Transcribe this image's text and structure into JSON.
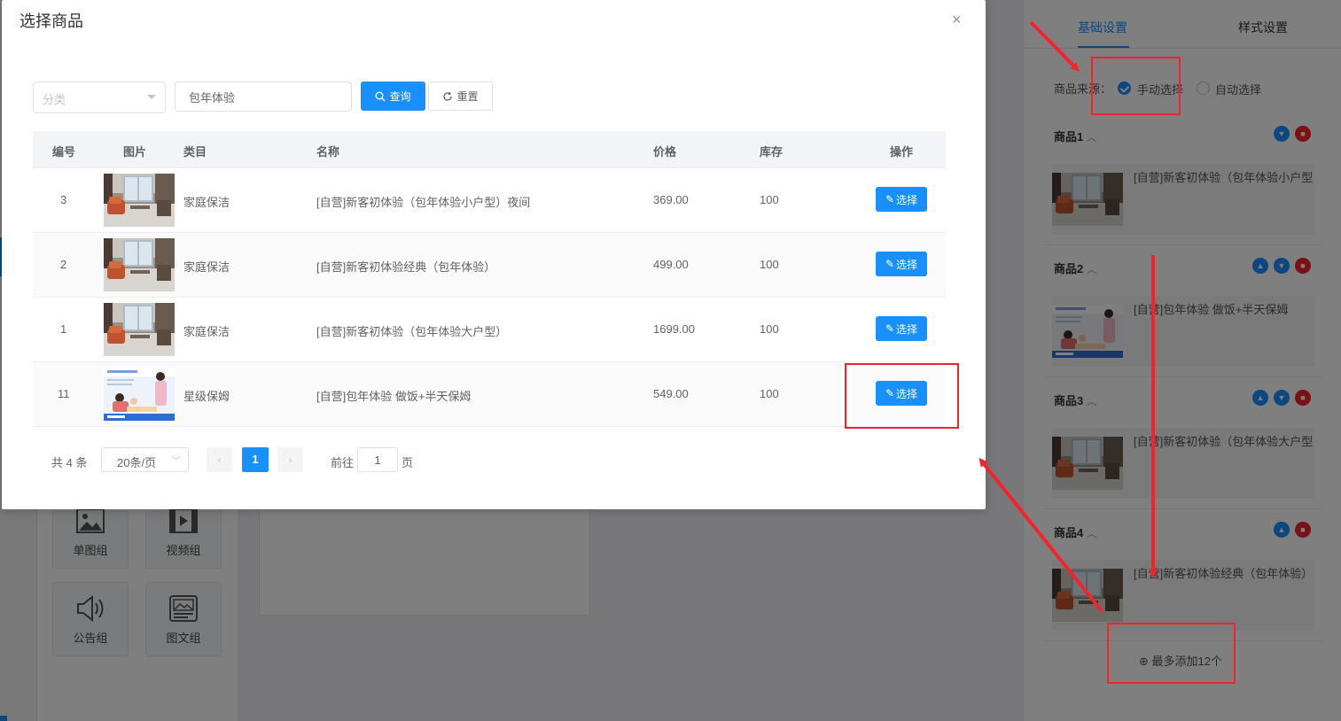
{
  "dialog": {
    "title": "选择商品",
    "close_icon": "×",
    "filter": {
      "category_placeholder": "分类",
      "keyword_value": "包年体验",
      "search_label": "查询",
      "reset_label": "重置"
    },
    "table": {
      "columns": [
        "编号",
        "图片",
        "类目",
        "名称",
        "价格",
        "库存",
        "操作"
      ],
      "rows": [
        {
          "id": "3",
          "category": "家庭保洁",
          "name": "[自营]新客初体验（包年体验小户型）夜间",
          "price": "369.00",
          "stock": "100",
          "action": "选择",
          "image": "living-room-photo"
        },
        {
          "id": "2",
          "category": "家庭保洁",
          "name": "[自营]新客初体验经典（包年体验）",
          "price": "499.00",
          "stock": "100",
          "action": "选择",
          "image": "living-room-photo"
        },
        {
          "id": "1",
          "category": "家庭保洁",
          "name": "[自营]新客初体验（包年体验大户型）",
          "price": "1699.00",
          "stock": "100",
          "action": "选择",
          "image": "living-room-photo"
        },
        {
          "id": "11",
          "category": "星级保姆",
          "name": "[自营]包年体验 做饭+半天保姆",
          "price": "549.00",
          "stock": "100",
          "action": "选择",
          "image": "nanny-photo"
        }
      ]
    },
    "pagination": {
      "total": "共 4 条",
      "page_size": "20条/页",
      "current_page": "1",
      "goto_label": "前往",
      "goto_value": "1",
      "page_suffix": "页"
    }
  },
  "right_panel": {
    "tabs": [
      "基础设置",
      "样式设置"
    ],
    "active_tab": "基础设置",
    "source_label": "商品来源：",
    "source_options": [
      "手动选择",
      "自动选择"
    ],
    "source_selected": "手动选择",
    "products": [
      {
        "label": "商品1",
        "title": "[自营]新客初体验（包年体验小户型",
        "image": "living-room-photo"
      },
      {
        "label": "商品2",
        "title": "[自营]包年体验 做饭+半天保姆",
        "image": "nanny-photo"
      },
      {
        "label": "商品3",
        "title": "[自营]新客初体验（包年体验大户型",
        "image": "living-room-photo"
      },
      {
        "label": "商品4",
        "title": "[自营]新客初体验经典（包年体验）",
        "image": "living-room-photo"
      }
    ],
    "add_more": "最多添加12个"
  },
  "components": [
    {
      "label": "单图组",
      "icon": "image-icon"
    },
    {
      "label": "视频组",
      "icon": "video-icon"
    },
    {
      "label": "公告组",
      "icon": "speaker-icon"
    },
    {
      "label": "图文组",
      "icon": "image-text-icon"
    }
  ],
  "colors": {
    "primary": "#1890ff",
    "danger": "#f5222d",
    "annotation": "#f5222d"
  }
}
